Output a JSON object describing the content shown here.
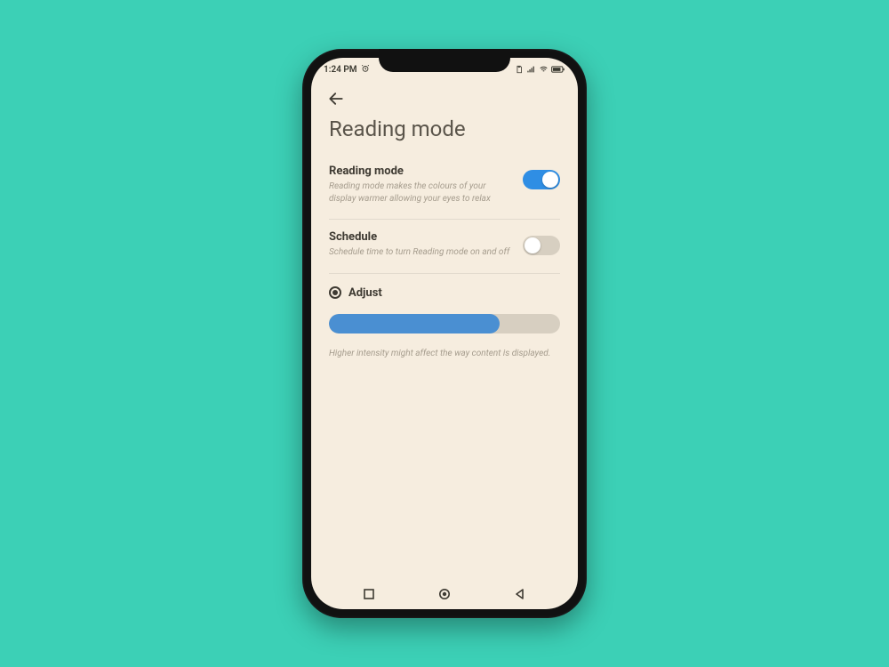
{
  "statusbar": {
    "time": "1:24 PM"
  },
  "page": {
    "title": "Reading mode"
  },
  "readingMode": {
    "title": "Reading mode",
    "desc": "Reading mode makes the colours of your display warmer allowing your eyes to relax",
    "enabled": true
  },
  "schedule": {
    "title": "Schedule",
    "desc": "Schedule time to turn Reading mode on and off",
    "enabled": false
  },
  "adjust": {
    "label": "Adjust",
    "percent": 74,
    "note": "Higher intensity might affect the way content is displayed."
  },
  "colors": {
    "accent": "#2f8ee4",
    "sliderFill": "#4a8fd2",
    "screenBg": "#f6eddf"
  }
}
